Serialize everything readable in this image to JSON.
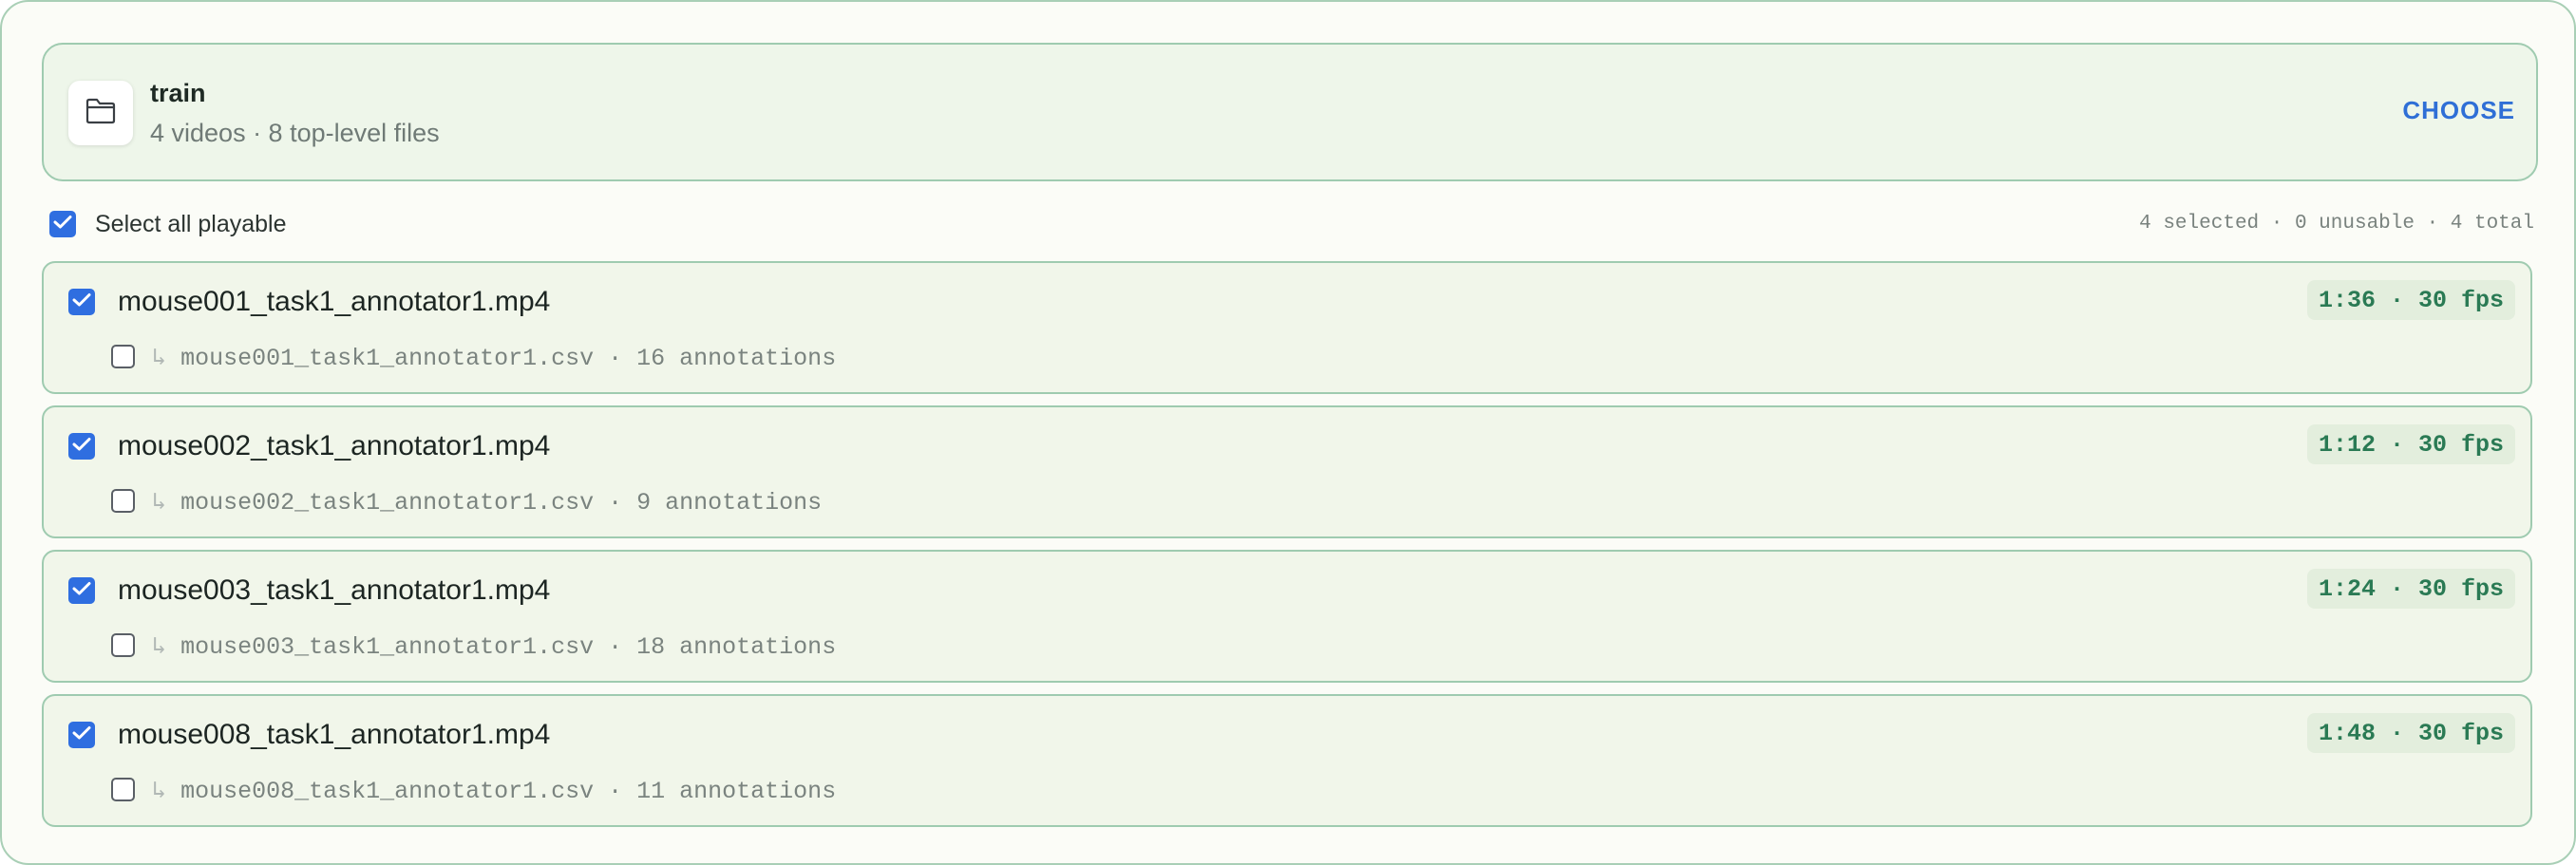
{
  "folder": {
    "icon": "folder-icon",
    "name": "train",
    "meta": "4 videos · 8 top-level files",
    "choose_label": "CHOOSE"
  },
  "selection": {
    "select_all_label": "Select all playable",
    "select_all_checked": true,
    "summary": "4 selected · 0 unusable · 4 total"
  },
  "videos": [
    {
      "checked": true,
      "name": "mouse001_task1_annotator1.mp4",
      "badge": "1:36 · 30 fps",
      "annotation": {
        "checked": false,
        "arrow": "↳",
        "text": "mouse001_task1_annotator1.csv · 16 annotations"
      }
    },
    {
      "checked": true,
      "name": "mouse002_task1_annotator1.mp4",
      "badge": "1:12 · 30 fps",
      "annotation": {
        "checked": false,
        "arrow": "↳",
        "text": "mouse002_task1_annotator1.csv · 9 annotations"
      }
    },
    {
      "checked": true,
      "name": "mouse003_task1_annotator1.mp4",
      "badge": "1:24 · 30 fps",
      "annotation": {
        "checked": false,
        "arrow": "↳",
        "text": "mouse003_task1_annotator1.csv · 18 annotations"
      }
    },
    {
      "checked": true,
      "name": "mouse008_task1_annotator1.mp4",
      "badge": "1:48 · 30 fps",
      "annotation": {
        "checked": false,
        "arrow": "↳",
        "text": "mouse008_task1_annotator1.csv · 11 annotations"
      }
    }
  ],
  "colors": {
    "accent": "#2f6ee0",
    "choose": "#2f6fd6",
    "badge_text": "#2a7a54",
    "border": "#9fcbb0"
  }
}
